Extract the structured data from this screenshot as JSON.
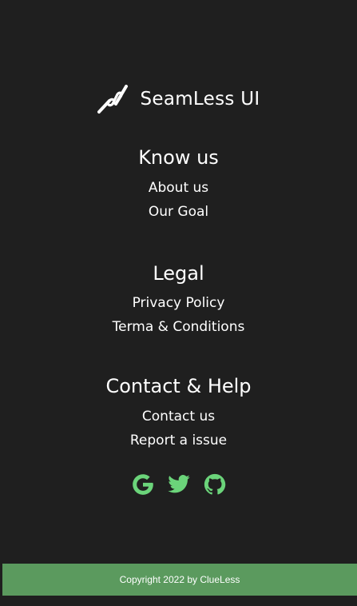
{
  "brand": {
    "title": "SeamLess UI",
    "logo_icon": "seamless-logo-icon"
  },
  "sections": [
    {
      "heading": "Know us",
      "links": [
        "About us",
        "Our Goal"
      ]
    },
    {
      "heading": "Legal",
      "links": [
        "Privacy Policy",
        "Terma & Conditions"
      ]
    },
    {
      "heading": "Contact & Help",
      "links": [
        "Contact us",
        "Report a issue"
      ]
    }
  ],
  "social": [
    {
      "icon": "google-icon"
    },
    {
      "icon": "twitter-icon"
    },
    {
      "icon": "github-icon"
    }
  ],
  "colors": {
    "background": "#1f1f1f",
    "accent": "#6bd47a",
    "footer": "#5b9a5e"
  },
  "footer": {
    "copyright": "Copyright 2022 by ClueLess"
  }
}
